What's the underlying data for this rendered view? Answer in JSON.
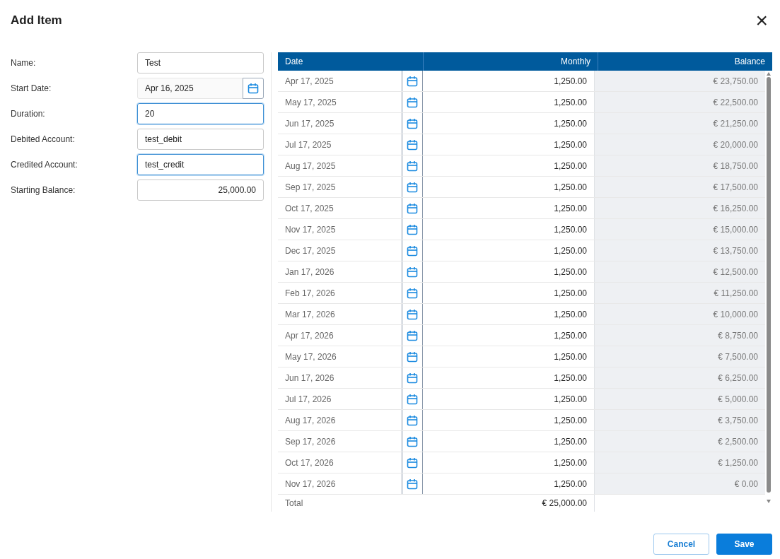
{
  "dialog": {
    "title": "Add Item",
    "close": "×"
  },
  "form": [
    {
      "label": "Name:",
      "value": "Test",
      "kind": "text",
      "highlighted": false
    },
    {
      "label": "Start Date:",
      "value": "Apr 16, 2025",
      "kind": "date",
      "highlighted": false
    },
    {
      "label": "Duration:",
      "value": "20",
      "kind": "text",
      "highlighted": true
    },
    {
      "label": "Debited Account:",
      "value": "test_debit",
      "kind": "text",
      "highlighted": false
    },
    {
      "label": "Credited Account:",
      "value": "test_credit",
      "kind": "text",
      "highlighted": true
    },
    {
      "label": "Starting Balance:",
      "value": "25,000.00",
      "kind": "number",
      "highlighted": false
    }
  ],
  "table": {
    "columns": [
      "Date",
      "Monthly",
      "Balance"
    ],
    "rows": [
      {
        "date": "Apr 17, 2025",
        "monthly": "1,250.00",
        "balance": "€ 23,750.00"
      },
      {
        "date": "May 17, 2025",
        "monthly": "1,250.00",
        "balance": "€ 22,500.00"
      },
      {
        "date": "Jun 17, 2025",
        "monthly": "1,250.00",
        "balance": "€ 21,250.00"
      },
      {
        "date": "Jul 17, 2025",
        "monthly": "1,250.00",
        "balance": "€ 20,000.00"
      },
      {
        "date": "Aug 17, 2025",
        "monthly": "1,250.00",
        "balance": "€ 18,750.00"
      },
      {
        "date": "Sep 17, 2025",
        "monthly": "1,250.00",
        "balance": "€ 17,500.00"
      },
      {
        "date": "Oct 17, 2025",
        "monthly": "1,250.00",
        "balance": "€ 16,250.00"
      },
      {
        "date": "Nov 17, 2025",
        "monthly": "1,250.00",
        "balance": "€ 15,000.00"
      },
      {
        "date": "Dec 17, 2025",
        "monthly": "1,250.00",
        "balance": "€ 13,750.00"
      },
      {
        "date": "Jan 17, 2026",
        "monthly": "1,250.00",
        "balance": "€ 12,500.00"
      },
      {
        "date": "Feb 17, 2026",
        "monthly": "1,250.00",
        "balance": "€ 11,250.00"
      },
      {
        "date": "Mar 17, 2026",
        "monthly": "1,250.00",
        "balance": "€ 10,000.00"
      },
      {
        "date": "Apr 17, 2026",
        "monthly": "1,250.00",
        "balance": "€ 8,750.00"
      },
      {
        "date": "May 17, 2026",
        "monthly": "1,250.00",
        "balance": "€ 7,500.00"
      },
      {
        "date": "Jun 17, 2026",
        "monthly": "1,250.00",
        "balance": "€ 6,250.00"
      },
      {
        "date": "Jul 17, 2026",
        "monthly": "1,250.00",
        "balance": "€ 5,000.00"
      },
      {
        "date": "Aug 17, 2026",
        "monthly": "1,250.00",
        "balance": "€ 3,750.00"
      },
      {
        "date": "Sep 17, 2026",
        "monthly": "1,250.00",
        "balance": "€ 2,500.00"
      },
      {
        "date": "Oct 17, 2026",
        "monthly": "1,250.00",
        "balance": "€ 1,250.00"
      },
      {
        "date": "Nov 17, 2026",
        "monthly": "1,250.00",
        "balance": "€ 0.00"
      }
    ],
    "total": {
      "label": "Total",
      "monthly": "€ 25,000.00"
    }
  },
  "buttons": [
    {
      "label": "Cancel",
      "kind": "secondary"
    },
    {
      "label": "Save",
      "kind": "primary"
    }
  ]
}
